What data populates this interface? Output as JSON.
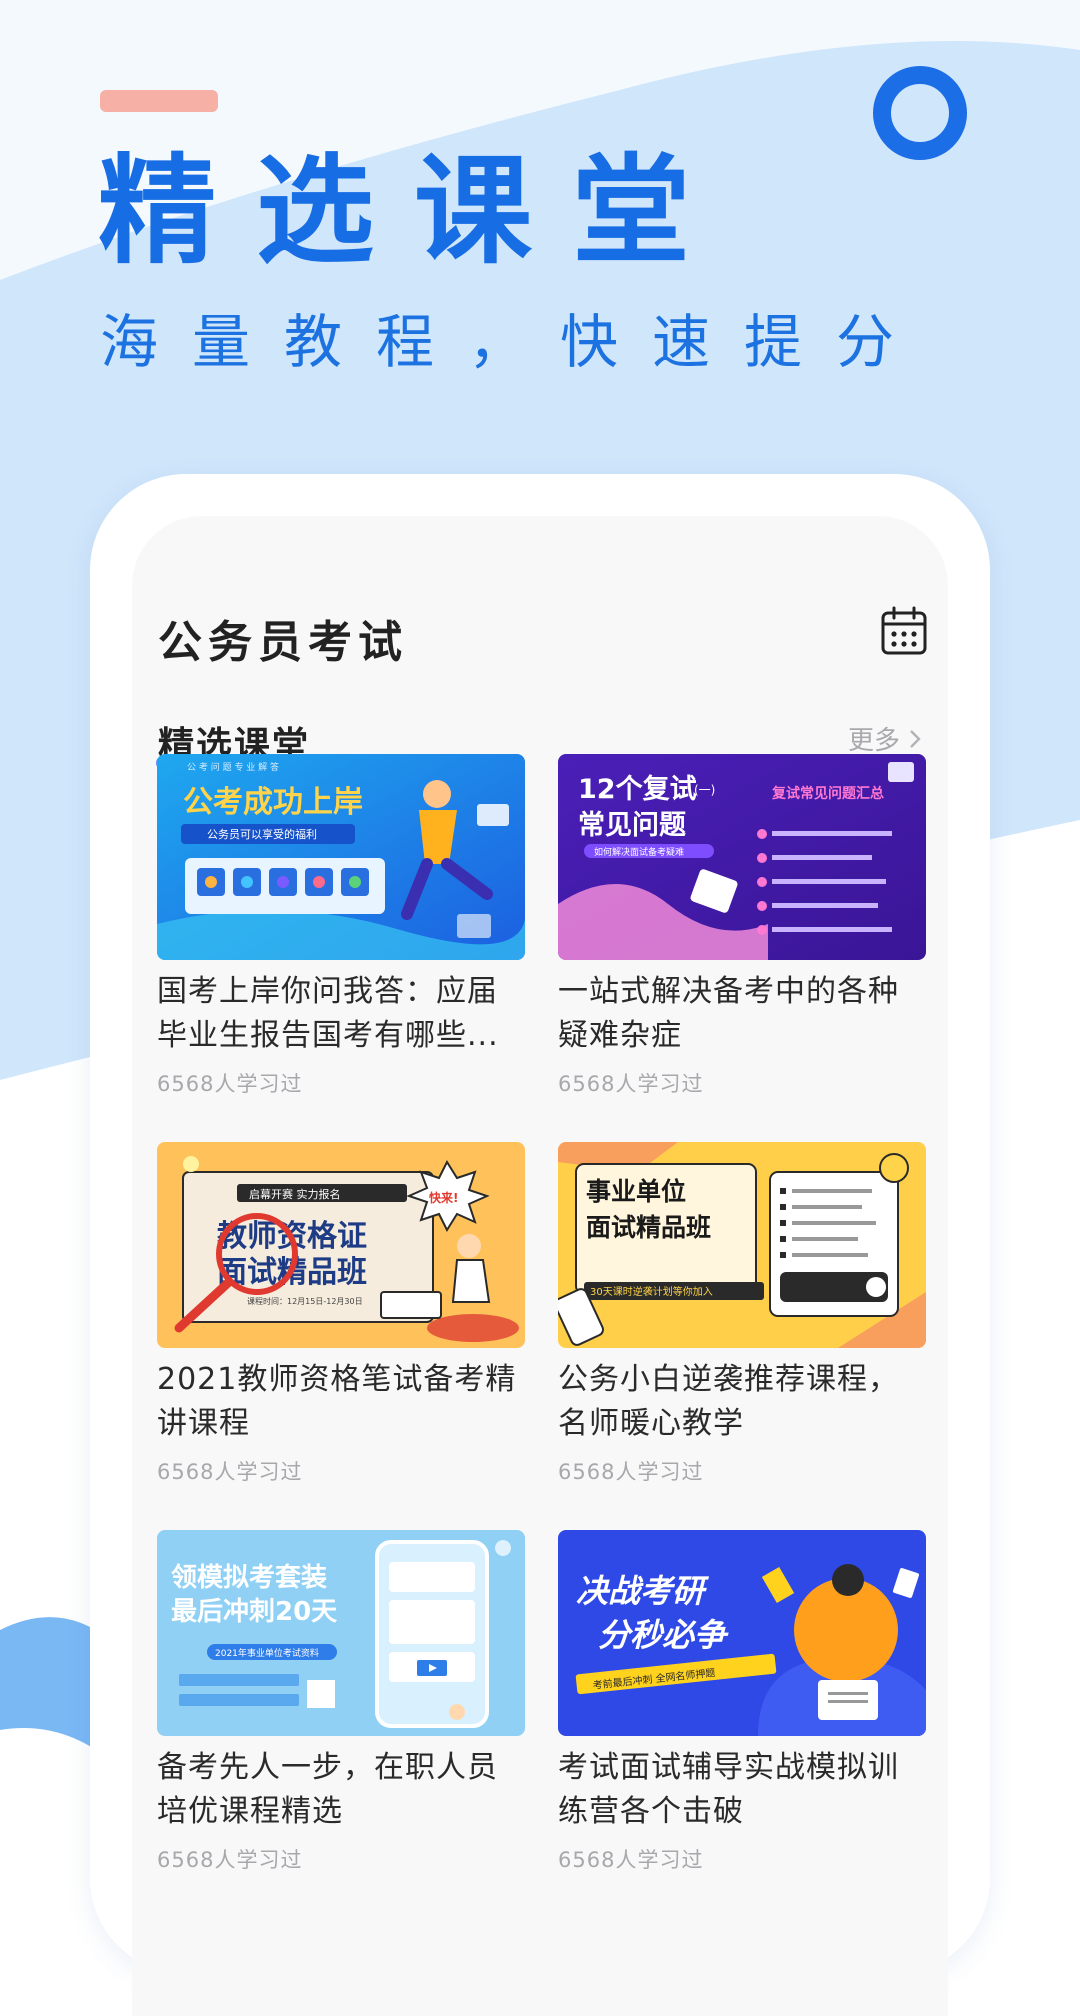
{
  "hero": {
    "title": "精选课堂",
    "subtitle": "海量教程，快速提分"
  },
  "app": {
    "title": "公务员考试"
  },
  "section": {
    "title": "精选课堂",
    "more": "更多"
  },
  "courses": [
    {
      "title": "国考上岸你问我答：应届毕业生报告国考有哪些...",
      "meta": "6568人学习过",
      "banner_headline": "公考成功上岸",
      "banner_tag": "公务员可以享受的福利",
      "banner_kicker": "公 考 问 题 专 业 解 答"
    },
    {
      "title": "一站式解决备考中的各种疑难杂症",
      "meta": "6568人学习过",
      "banner_headline_1": "12个复试",
      "banner_headline_2": "常见问题",
      "banner_badge": "(一)",
      "banner_side": "复试常见问题汇总",
      "banner_tag": "如何解决面试备考疑难"
    },
    {
      "title": "2021教师资格笔试备考精讲课程",
      "meta": "6568人学习过",
      "banner_kicker": "启幕开赛 实力报名",
      "banner_headline_1": "教师资格证",
      "banner_headline_2": "面试精品班",
      "banner_burst": "快来!",
      "banner_date": "课程时间：12月15日-12月30日"
    },
    {
      "title": "公务小白逆袭推荐课程，名师暖心教学",
      "meta": "6568人学习过",
      "banner_headline_1": "事业单位",
      "banner_headline_2": "面试精品班",
      "banner_tag": "30天课时逆袭计划等你加入"
    },
    {
      "title": "备考先人一步，在职人员培优课程精选",
      "meta": "6568人学习过",
      "banner_headline_1": "领模拟考套装",
      "banner_headline_2": "最后冲刺20天",
      "banner_tag": "2021年事业单位考试资料"
    },
    {
      "title": "考试面试辅导实战模拟训练营各个击破",
      "meta": "6568人学习过",
      "banner_headline_1": "决战考研",
      "banner_headline_2": "分秒必争",
      "banner_tag": "考前最后冲刺 全网名师押题"
    }
  ],
  "colors": {
    "primary": "#176de3",
    "accent_pink": "#f6b0a6",
    "wave_light": "#d2e7fb",
    "text_muted": "#a8a8ac"
  },
  "icons": {
    "calendar": "calendar-icon",
    "more_chevron": "chevron-right-icon",
    "ring": "ring-decoration"
  }
}
